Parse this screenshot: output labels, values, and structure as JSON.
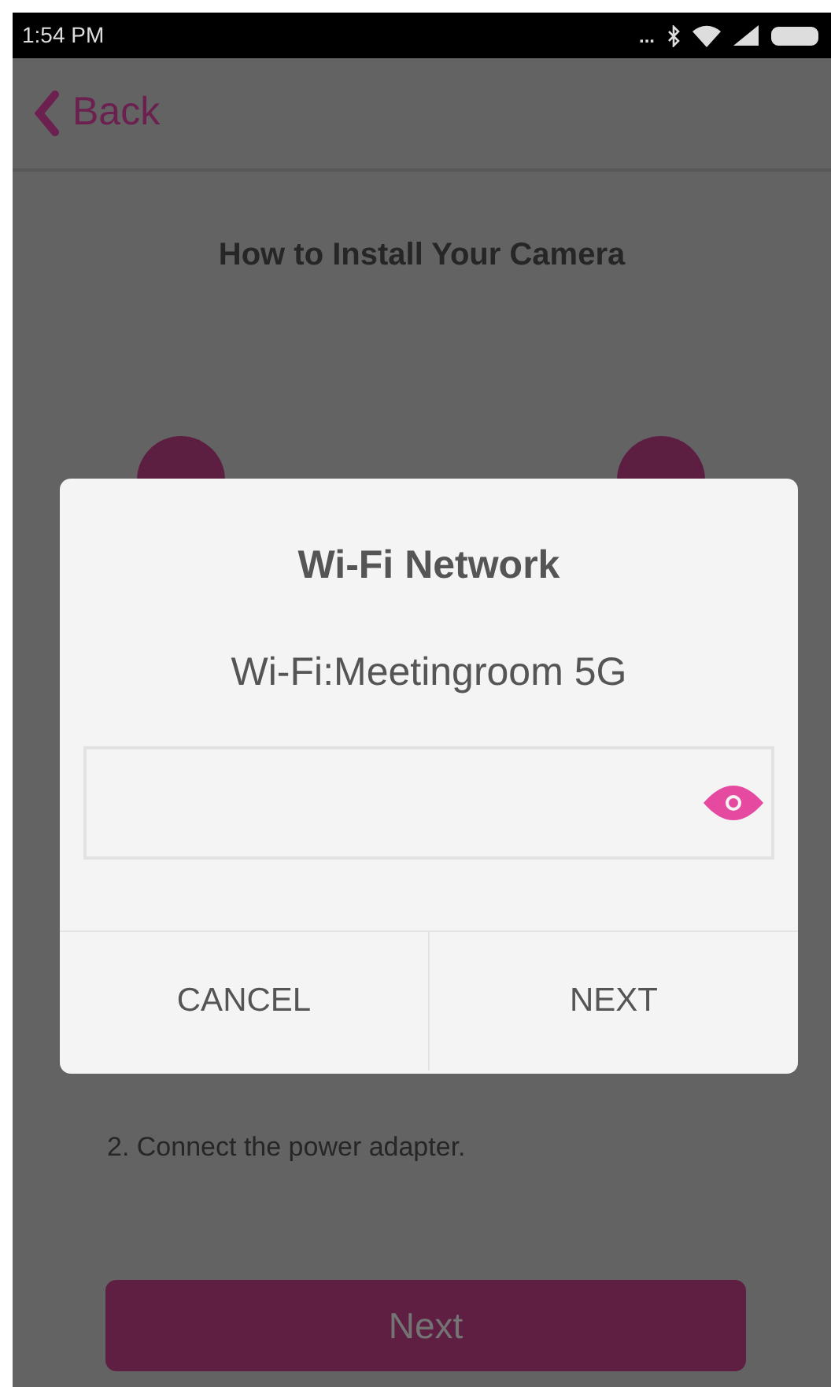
{
  "status_bar": {
    "time": "1:54 PM",
    "more": "..."
  },
  "header": {
    "back": "Back"
  },
  "page": {
    "title": "How to Install Your Camera",
    "instruction": "2. Connect the power adapter.",
    "next_button": "Next"
  },
  "dialog": {
    "title": "Wi-Fi Network",
    "network": "Wi-Fi:Meetingroom 5G",
    "buttons": [
      "CANCEL",
      "NEXT"
    ]
  }
}
